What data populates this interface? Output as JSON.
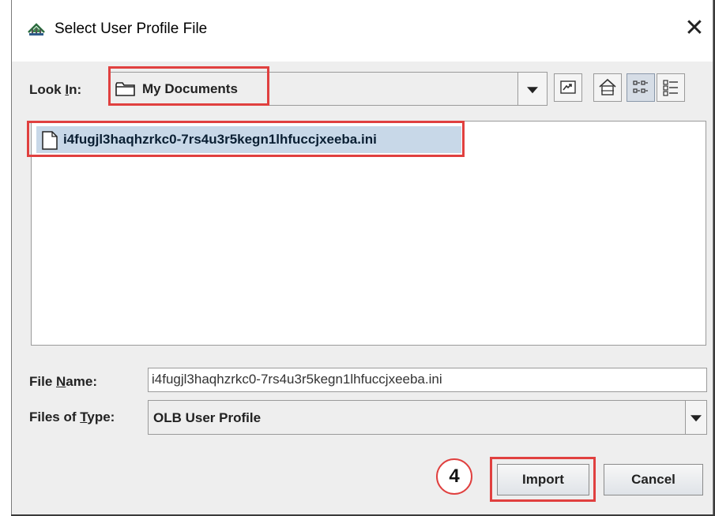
{
  "window": {
    "title": "Select User Profile File",
    "close_glyph": "✕"
  },
  "look_in": {
    "label_prefix": "Look ",
    "label_mnemonic": "I",
    "label_suffix": "n:",
    "selected_value": "My Documents",
    "icon": "folder-icon"
  },
  "toolbar": {
    "buttons": [
      {
        "name": "up-one-level",
        "icon": "up-folder-icon"
      },
      {
        "name": "home",
        "icon": "home-icon"
      },
      {
        "name": "list-view",
        "icon": "list-view-icon",
        "active": true
      },
      {
        "name": "details-view",
        "icon": "details-view-icon",
        "active": false
      }
    ]
  },
  "files": [
    {
      "name": "i4fugjl3haqhzrkc0-7rs4u3r5kegn1lhfuccjxeeba.ini",
      "selected": true,
      "icon": "file-icon"
    }
  ],
  "file_name": {
    "label_prefix": "File ",
    "label_mnemonic": "N",
    "label_suffix": "ame:",
    "value": "i4fugjl3haqhzrkc0-7rs4u3r5kegn1lhfuccjxeeba.ini"
  },
  "file_type": {
    "label_prefix": "Files of ",
    "label_mnemonic": "T",
    "label_suffix": "ype:",
    "selected_value": "OLB User Profile"
  },
  "buttons": {
    "import_label": "Import",
    "cancel_label": "Cancel"
  },
  "step_badge": {
    "number": "4"
  },
  "colors": {
    "highlight": "#e0403f",
    "selection": "#c8d8e8",
    "panel_bg": "#eeeeee"
  }
}
